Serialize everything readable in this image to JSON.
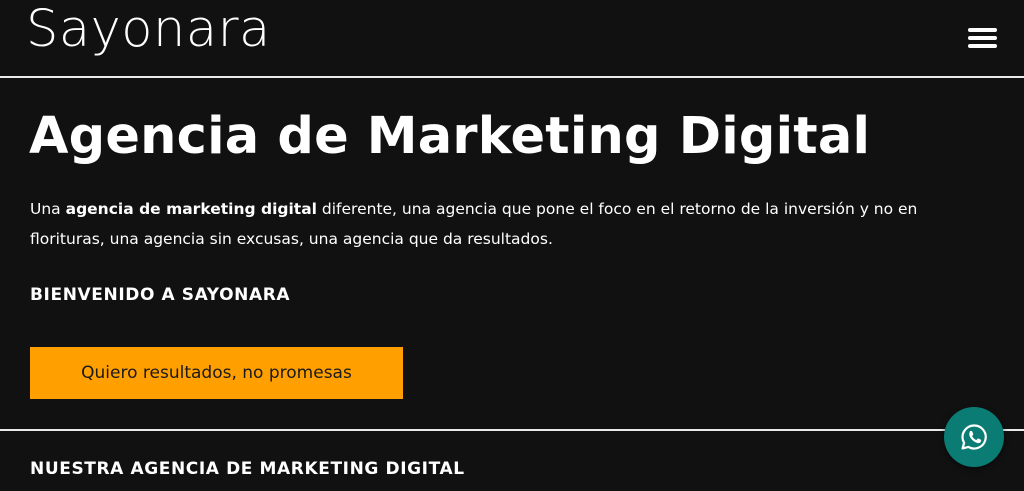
{
  "header": {
    "logo_text": "Sayonara",
    "menu_icon": "hamburger-menu-icon"
  },
  "hero": {
    "title": "Agencia de Marketing Digital",
    "intro_prefix": "Una ",
    "intro_bold": "agencia de marketing digital",
    "intro_suffix": " diferente, una agencia que pone el foco en el retorno de la inversión y no en florituras, una agencia sin excusas, una agencia que da resultados.",
    "welcome": "BIENVENIDO A SAYONARA",
    "cta_label": "Quiero resultados, no promesas"
  },
  "section": {
    "heading": "NUESTRA AGENCIA DE MARKETING DIGITAL"
  },
  "floating": {
    "whatsapp_icon": "whatsapp-icon"
  },
  "colors": {
    "background": "#121112",
    "cta_background": "#ff9f00",
    "whatsapp_background": "#0a7c74",
    "text": "#ffffff"
  }
}
